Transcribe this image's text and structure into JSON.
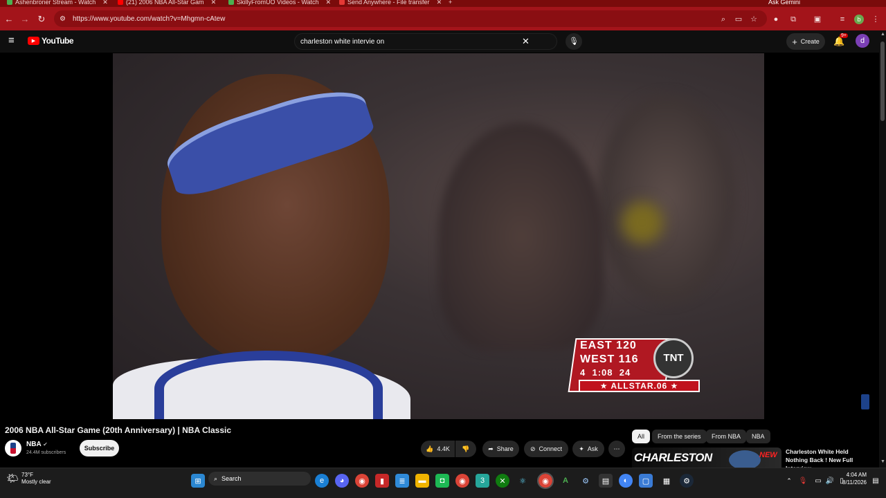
{
  "browser": {
    "tabs": [
      {
        "title": "Ashenbroner Stream - Watch",
        "color": "#4caf50"
      },
      {
        "title": "(21) 2006 NBA All-Star Gam",
        "color": "#ff0000"
      },
      {
        "title": "SkillyFromUO Videos - Watch",
        "color": "#4caf50"
      },
      {
        "title": "Send Anywhere - File transfer",
        "color": "#e53935"
      }
    ],
    "ask_gemini": "Ask Gemini",
    "url": "https://www.youtube.com/watch?v=Mhgmn-cAtew",
    "profile_initial": "b"
  },
  "youtube": {
    "logo_text": "YouTube",
    "search_value": "charleston white intervie on",
    "create_label": "Create",
    "notif_count": "9+",
    "account_initial": "d"
  },
  "scoreboard": {
    "east_label": "EAST",
    "east_score": "120",
    "west_label": "WEST",
    "west_score": "116",
    "quarter": "4",
    "clock": "1:08",
    "shot_clock": "24",
    "network": "TNT",
    "banner": "★ ALLSTAR.06 ★"
  },
  "video_info": {
    "title": "2006 NBA All-Star Game (20th Anniversary) | NBA Classic",
    "channel": "NBA",
    "subscribers": "24.4M subscribers",
    "subscribe_label": "Subscribe",
    "likes": "4.4K",
    "share_label": "Share",
    "connect_label": "Connect",
    "ask_label": "Ask"
  },
  "chips": [
    "All",
    "From the series",
    "From NBA",
    "NBA"
  ],
  "recommendation": {
    "thumb_text": "CHARLESTON",
    "thumb_badge": "NEW",
    "title": "Charleston White Held Nothing Back ! New Full Interview"
  },
  "taskbar": {
    "weather_temp": "73°F",
    "weather_desc": "Mostly clear",
    "search_label": "Search",
    "time": "4:04 AM",
    "date": "8/11/2026"
  }
}
